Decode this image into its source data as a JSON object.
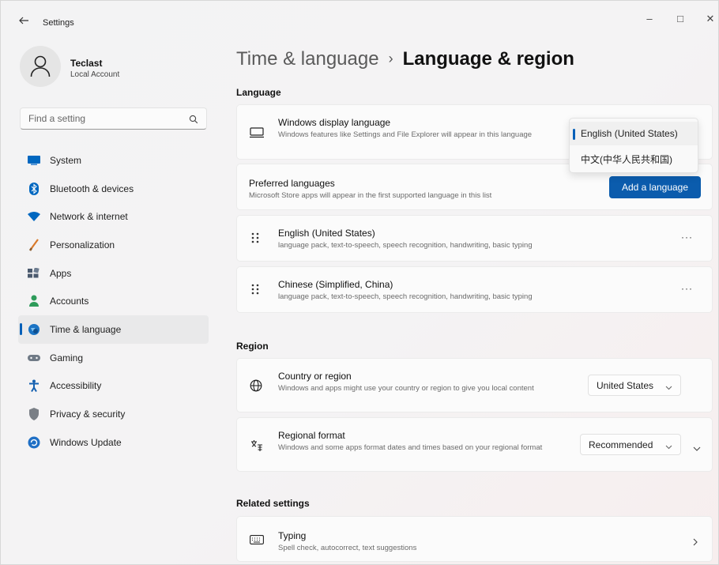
{
  "window": {
    "title": "Settings",
    "controls": {
      "minimize": "–",
      "maximize": "□",
      "close": "✕"
    }
  },
  "profile": {
    "name": "Teclast",
    "account_type": "Local Account"
  },
  "search": {
    "placeholder": "Find a setting"
  },
  "nav": {
    "items": [
      {
        "label": "System",
        "icon": "system-icon",
        "color": "#0067c0"
      },
      {
        "label": "Bluetooth & devices",
        "icon": "bluetooth-icon",
        "color": "#0067c0"
      },
      {
        "label": "Network & internet",
        "icon": "wifi-icon",
        "color": "#0067c0"
      },
      {
        "label": "Personalization",
        "icon": "brush-icon",
        "color": "#d97a2b"
      },
      {
        "label": "Apps",
        "icon": "apps-icon",
        "color": "#4b5a6e"
      },
      {
        "label": "Accounts",
        "icon": "accounts-icon",
        "color": "#2e9b5a"
      },
      {
        "label": "Time & language",
        "icon": "globe-clock-icon",
        "color": "#1a73c4",
        "active": true
      },
      {
        "label": "Gaming",
        "icon": "gamepad-icon",
        "color": "#707a86"
      },
      {
        "label": "Accessibility",
        "icon": "accessibility-icon",
        "color": "#1560b0"
      },
      {
        "label": "Privacy & security",
        "icon": "shield-icon",
        "color": "#7a7f86"
      },
      {
        "label": "Windows Update",
        "icon": "update-icon",
        "color": "#1f6fc5"
      }
    ]
  },
  "breadcrumb": {
    "parent": "Time & language",
    "separator": "›",
    "current": "Language & region"
  },
  "language_section": {
    "title": "Language",
    "display_language": {
      "title": "Windows display language",
      "description": "Windows features like Settings and File Explorer will appear in this language",
      "options": [
        "English (United States)",
        "中文(中华人民共和国)"
      ],
      "selected": "English (United States)"
    },
    "preferred": {
      "title": "Preferred languages",
      "description": "Microsoft Store apps will appear in the first supported language in this list",
      "button": "Add a language"
    },
    "languages": [
      {
        "name": "English (United States)",
        "features": "language pack, text-to-speech, speech recognition, handwriting, basic typing",
        "more": "···"
      },
      {
        "name": "Chinese (Simplified, China)",
        "features": "language pack, text-to-speech, speech recognition, handwriting, basic typing",
        "more": "···"
      }
    ]
  },
  "region_section": {
    "title": "Region",
    "country": {
      "title": "Country or region",
      "description": "Windows and apps might use your country or region to give you local content",
      "value": "United States"
    },
    "format": {
      "title": "Regional format",
      "description": "Windows and some apps format dates and times based on your regional format",
      "value": "Recommended"
    }
  },
  "related_section": {
    "title": "Related settings",
    "typing": {
      "title": "Typing",
      "description": "Spell check, autocorrect, text suggestions"
    }
  },
  "colors": {
    "accent": "#005fb8",
    "button": "#0b5cad"
  }
}
